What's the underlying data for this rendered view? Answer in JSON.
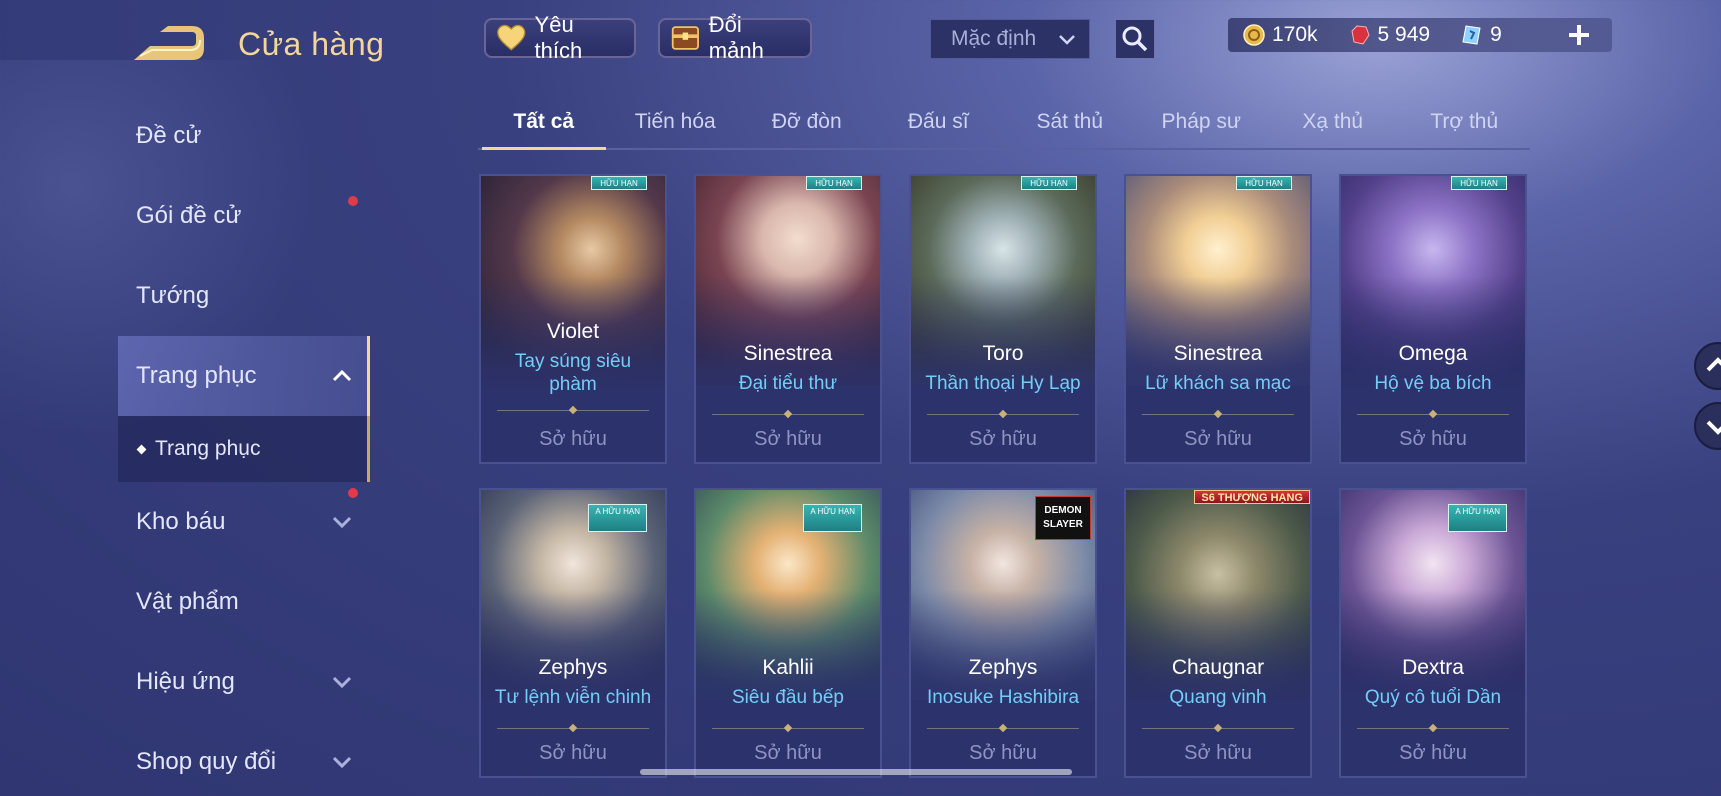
{
  "header": {
    "title": "Cửa hàng",
    "favorites_label": "Yêu thích",
    "exchange_label": "Đổi mảnh",
    "sort_value": "Mặc định"
  },
  "currencies": {
    "gold": "170k",
    "ruby": "5 949",
    "coupon": "9"
  },
  "sidebar": {
    "items": [
      {
        "label": "Đề cử"
      },
      {
        "label": "Gói đề cử"
      },
      {
        "label": "Tướng"
      },
      {
        "label": "Trang phục"
      },
      {
        "label": "Trang phục"
      },
      {
        "label": "Kho báu"
      },
      {
        "label": "Vật phẩm"
      },
      {
        "label": "Hiệu ứng"
      },
      {
        "label": "Shop quy đổi"
      }
    ]
  },
  "tabs": [
    {
      "label": "Tất cả"
    },
    {
      "label": "Tiến hóa"
    },
    {
      "label": "Đỡ đòn"
    },
    {
      "label": "Đấu sĩ"
    },
    {
      "label": "Sát thủ"
    },
    {
      "label": "Pháp sư"
    },
    {
      "label": "Xạ thủ"
    },
    {
      "label": "Trợ thủ"
    }
  ],
  "cards": [
    {
      "hero": "Violet",
      "skin": "Tay súng siêu phàm",
      "status": "Sở hữu",
      "badge": "HỮU HẠN"
    },
    {
      "hero": "Sinestrea",
      "skin": "Đại tiểu thư",
      "status": "Sở hữu",
      "badge": "HỮU HẠN"
    },
    {
      "hero": "Toro",
      "skin": "Thần thoại Hy Lạp",
      "status": "Sở hữu",
      "badge": "HỮU HẠN"
    },
    {
      "hero": "Sinestrea",
      "skin": "Lữ khách sa mạc",
      "status": "Sở hữu",
      "badge": "HỮU HẠN"
    },
    {
      "hero": "Omega",
      "skin": "Hộ vệ ba bích",
      "status": "Sở hữu",
      "badge": "HỮU HẠN"
    },
    {
      "hero": "Zephys",
      "skin": "Tư lệnh viễn chinh",
      "status": "Sở hữu",
      "badge": "A HỮU HẠN"
    },
    {
      "hero": "Kahlii",
      "skin": "Siêu đầu bếp",
      "status": "Sở hữu",
      "badge": "A HỮU HẠN"
    },
    {
      "hero": "Zephys",
      "skin": "Inosuke Hashibira",
      "status": "Sở hữu",
      "badge": "DEMON SLAYER"
    },
    {
      "hero": "Chaugnar",
      "skin": "Quang vinh",
      "status": "Sở hữu",
      "badge": "S6 THƯỢNG HẠNG"
    },
    {
      "hero": "Dextra",
      "skin": "Quý cô tuổi Dần",
      "status": "Sở hữu",
      "badge": "A HỮU HẠN"
    }
  ],
  "colors": {
    "accent_gold": "#f3d79a",
    "skin_name": "#73cdf7",
    "notification": "#e23a4a"
  }
}
